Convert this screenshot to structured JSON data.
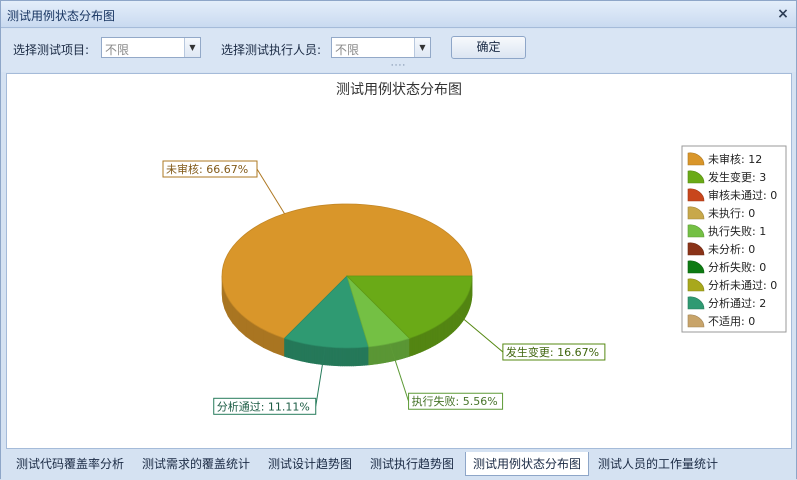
{
  "window": {
    "title": "测试用例状态分布图",
    "close_glyph": "×"
  },
  "toolbar": {
    "project_label": "选择测试项目:",
    "project_value": "不限",
    "executor_label": "选择测试执行人员:",
    "executor_value": "不限",
    "confirm_label": "确定",
    "splitter_glyph": "····"
  },
  "tabs": [
    {
      "label": "测试代码覆盖率分析",
      "active": false
    },
    {
      "label": "测试需求的覆盖统计",
      "active": false
    },
    {
      "label": "测试设计趋势图",
      "active": false
    },
    {
      "label": "测试执行趋势图",
      "active": false
    },
    {
      "label": "测试用例状态分布图",
      "active": true
    },
    {
      "label": "测试人员的工作量统计",
      "active": false
    }
  ],
  "chart_data": {
    "type": "pie",
    "title": "测试用例状态分布图",
    "legend_position": "right",
    "categories": [
      "未审核",
      "发生变更",
      "审核未通过",
      "未执行",
      "执行失败",
      "未分析",
      "分析失败",
      "分析未通过",
      "分析通过",
      "不适用"
    ],
    "values": [
      12,
      3,
      0,
      0,
      1,
      0,
      0,
      0,
      2,
      0
    ],
    "colors": [
      "#d9962a",
      "#6aaa17",
      "#c8461c",
      "#c8a84a",
      "#74c044",
      "#8a3318",
      "#0d7a12",
      "#a8a81c",
      "#2f9a72",
      "#c8a46a"
    ],
    "legend_entries": [
      "未审核: 12",
      "发生变更: 3",
      "审核未通过: 0",
      "未执行: 0",
      "执行失败: 1",
      "未分析: 0",
      "分析失败: 0",
      "分析未通过: 0",
      "分析通过: 2",
      "不适用: 0"
    ],
    "data_labels": [
      {
        "index": 0,
        "text": "未审核: 66.67%"
      },
      {
        "index": 1,
        "text": "发生变更: 16.67%"
      },
      {
        "index": 4,
        "text": "执行失败: 5.56%"
      },
      {
        "index": 8,
        "text": "分析通过: 11.11%"
      }
    ]
  }
}
